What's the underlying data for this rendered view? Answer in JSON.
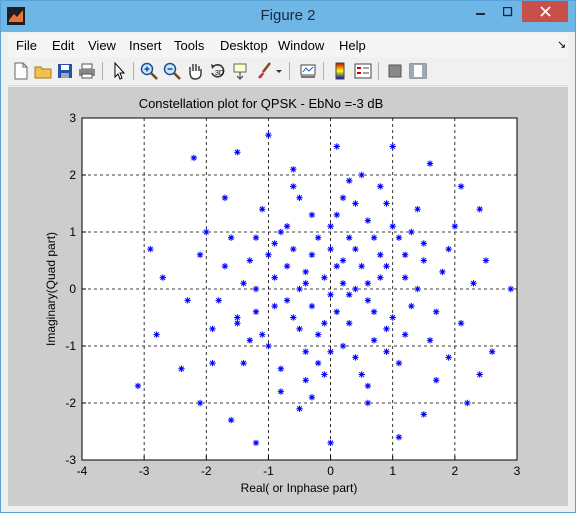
{
  "window": {
    "title": "Figure 2",
    "close_glyph": "✕",
    "minimize_glyph": "—",
    "maximize_glyph": "□"
  },
  "menu": [
    "File",
    "Edit",
    "View",
    "Insert",
    "Tools",
    "Desktop",
    "Window",
    "Help"
  ],
  "menu_dock_glyph": "↘",
  "toolbar": [
    "new-figure-icon",
    "open-file-icon",
    "save-icon",
    "print-icon",
    "edit-plot-arrow-icon",
    "zoom-in-icon",
    "zoom-out-icon",
    "pan-hand-icon",
    "rotate-3d-icon",
    "data-cursor-icon",
    "brush-icon",
    "link-plot-icon",
    "insert-colorbar-icon",
    "insert-legend-icon",
    "hide-plot-tools-icon",
    "show-plot-tools-icon"
  ],
  "chart_data": {
    "type": "scatter",
    "title": "Constellation plot for QPSK - EbNo =-3 dB",
    "xlabel": "Real( or Inphase part)",
    "ylabel": "Imaginary(Quad part)",
    "xlim": [
      -4,
      3
    ],
    "ylim": [
      -3,
      3
    ],
    "xticks": [
      -4,
      -3,
      -2,
      -1,
      0,
      1,
      2,
      3
    ],
    "yticks": [
      -3,
      -2,
      -1,
      0,
      1,
      2,
      3
    ],
    "grid": "dashed",
    "marker": "*",
    "color": "#0000ff",
    "series": [
      {
        "points": [
          [
            0.0,
            0.7
          ],
          [
            0.2,
            0.1
          ],
          [
            -0.4,
            0.3
          ],
          [
            0.6,
            -0.2
          ],
          [
            -0.6,
            -0.5
          ],
          [
            0.3,
            0.9
          ],
          [
            -0.2,
            -0.8
          ],
          [
            0.8,
            0.6
          ],
          [
            -0.9,
            0.8
          ],
          [
            0.9,
            -0.7
          ],
          [
            -0.3,
            1.3
          ],
          [
            0.4,
            -1.2
          ],
          [
            1.2,
            0.2
          ],
          [
            -1.2,
            0.0
          ],
          [
            0.1,
            -0.4
          ],
          [
            -0.7,
            1.1
          ],
          [
            1.0,
            1.1
          ],
          [
            -1.0,
            -1.0
          ],
          [
            0.7,
            -0.9
          ],
          [
            -0.5,
            0.0
          ],
          [
            0.5,
            0.4
          ],
          [
            1.3,
            -0.3
          ],
          [
            -1.3,
            0.5
          ],
          [
            0.2,
            1.6
          ],
          [
            -0.1,
            -1.5
          ],
          [
            1.5,
            0.8
          ],
          [
            -1.5,
            -0.6
          ],
          [
            0.9,
            1.5
          ],
          [
            -0.8,
            -1.4
          ],
          [
            1.1,
            -1.3
          ],
          [
            -1.1,
            1.4
          ],
          [
            0.0,
            -0.1
          ],
          [
            0.4,
            0.0
          ],
          [
            -0.3,
            -0.3
          ],
          [
            0.6,
            1.2
          ],
          [
            -0.6,
            0.7
          ],
          [
            1.6,
            -0.9
          ],
          [
            -1.6,
            0.9
          ],
          [
            0.3,
            -0.6
          ],
          [
            -0.4,
            -1.1
          ],
          [
            1.4,
            1.4
          ],
          [
            -1.4,
            -1.3
          ],
          [
            0.8,
            0.2
          ],
          [
            -0.9,
            0.2
          ],
          [
            0.1,
            0.4
          ],
          [
            -0.2,
            0.9
          ],
          [
            0.5,
            -1.5
          ],
          [
            -0.7,
            -0.2
          ],
          [
            1.2,
            0.6
          ],
          [
            -1.2,
            -0.4
          ],
          [
            0.7,
            0.9
          ],
          [
            -0.5,
            1.6
          ],
          [
            1.0,
            -0.5
          ],
          [
            -1.0,
            0.6
          ],
          [
            0.2,
            -1.0
          ],
          [
            -0.1,
            0.2
          ],
          [
            1.8,
            0.3
          ],
          [
            -1.8,
            -0.2
          ],
          [
            0.6,
            0.1
          ],
          [
            -0.3,
            0.6
          ],
          [
            1.1,
            0.9
          ],
          [
            -1.1,
            -0.8
          ],
          [
            0.4,
            1.5
          ],
          [
            -0.4,
            -1.6
          ],
          [
            1.7,
            -0.4
          ],
          [
            -1.7,
            0.4
          ],
          [
            0.9,
            -1.1
          ],
          [
            -0.8,
            1.0
          ],
          [
            0.0,
            1.1
          ],
          [
            0.0,
            -1.1
          ],
          [
            1.3,
            1.0
          ],
          [
            -1.3,
            -0.9
          ],
          [
            2.0,
            1.1
          ],
          [
            -2.0,
            1.0
          ],
          [
            1.9,
            -1.2
          ],
          [
            -1.9,
            -1.3
          ],
          [
            0.5,
            2.0
          ],
          [
            -0.6,
            2.1
          ],
          [
            0.6,
            -2.0
          ],
          [
            -0.5,
            -2.1
          ],
          [
            2.3,
            0.1
          ],
          [
            -2.3,
            -0.2
          ],
          [
            2.1,
            1.8
          ],
          [
            -2.2,
            2.3
          ],
          [
            2.2,
            -2.0
          ],
          [
            -2.1,
            -2.0
          ],
          [
            0.1,
            2.5
          ],
          [
            0.0,
            -2.7
          ],
          [
            -2.9,
            0.7
          ],
          [
            -2.8,
            -0.8
          ],
          [
            2.5,
            0.5
          ],
          [
            2.6,
            -1.1
          ],
          [
            -1.0,
            2.7
          ],
          [
            1.0,
            2.5
          ],
          [
            -1.2,
            -2.7
          ],
          [
            1.1,
            -2.6
          ],
          [
            2.9,
            0.0
          ],
          [
            -3.1,
            -1.7
          ],
          [
            -2.7,
            0.2
          ],
          [
            2.4,
            -1.5
          ],
          [
            1.6,
            2.2
          ],
          [
            -1.5,
            2.4
          ],
          [
            1.5,
            -2.2
          ],
          [
            -1.6,
            -2.3
          ],
          [
            0.3,
            1.9
          ],
          [
            -0.3,
            -1.9
          ],
          [
            1.9,
            0.7
          ],
          [
            -1.9,
            -0.7
          ],
          [
            0.8,
            1.8
          ],
          [
            -0.8,
            -1.8
          ],
          [
            1.7,
            -1.6
          ],
          [
            -1.7,
            1.6
          ],
          [
            2.1,
            -0.6
          ],
          [
            -2.1,
            0.6
          ],
          [
            0.6,
            -1.7
          ],
          [
            -0.6,
            1.8
          ],
          [
            1.4,
            0.0
          ],
          [
            -1.4,
            0.1
          ],
          [
            2.4,
            1.4
          ],
          [
            -2.4,
            -1.4
          ],
          [
            0.2,
            0.5
          ],
          [
            -0.1,
            -0.6
          ],
          [
            0.3,
            -0.1
          ],
          [
            -0.4,
            0.1
          ],
          [
            0.9,
            0.4
          ],
          [
            -0.9,
            -0.3
          ],
          [
            1.2,
            -0.8
          ],
          [
            -1.2,
            0.9
          ],
          [
            0.1,
            1.3
          ],
          [
            -0.2,
            -1.3
          ],
          [
            0.7,
            -0.4
          ],
          [
            -0.7,
            0.4
          ],
          [
            1.5,
            0.5
          ],
          [
            -1.5,
            -0.5
          ],
          [
            0.4,
            0.7
          ],
          [
            -0.5,
            -0.7
          ]
        ]
      }
    ]
  }
}
